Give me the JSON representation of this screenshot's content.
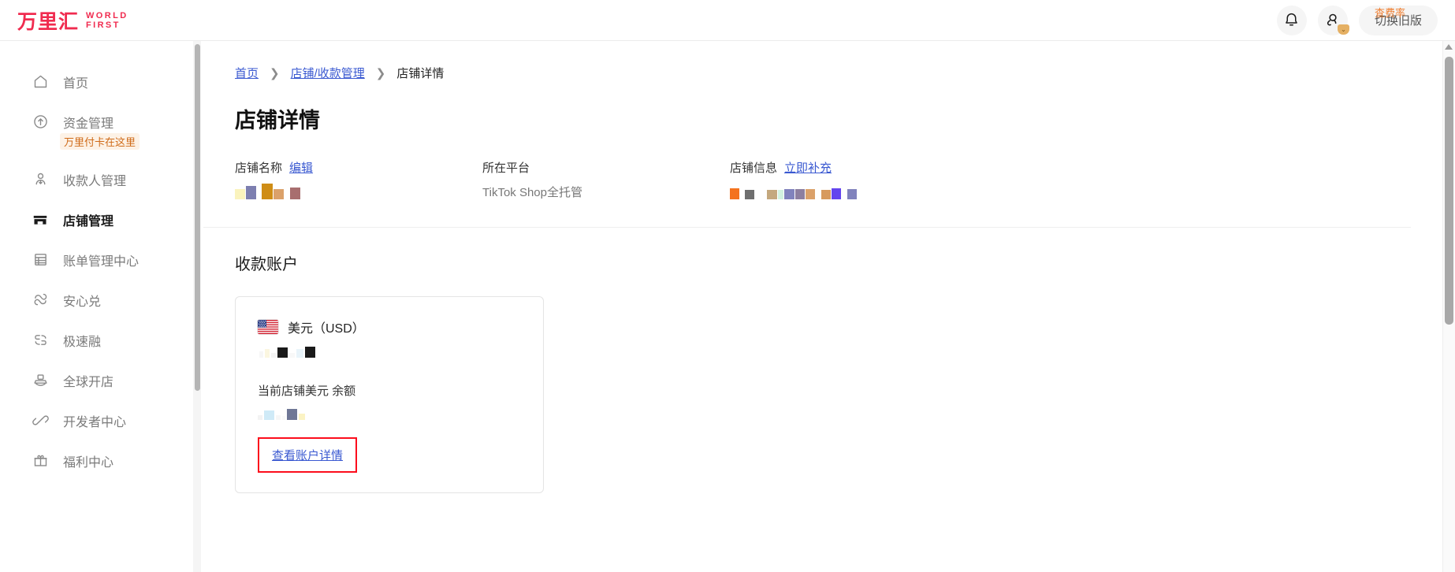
{
  "header": {
    "logo_cn": "万里汇",
    "logo_en_line1": "WORLD",
    "logo_en_line2": "FIRST",
    "rate_tip": "查费率",
    "switch_button": "切换旧版",
    "notification_icon": "bell-icon",
    "avatar_icon": "user-icon"
  },
  "sidebar": {
    "items": [
      {
        "label": "首页",
        "icon": "home-icon",
        "active": false
      },
      {
        "label": "资金管理",
        "icon": "arrow-up-circle-icon",
        "active": false,
        "badge": "万里付卡在这里"
      },
      {
        "label": "收款人管理",
        "icon": "payee-person-icon",
        "active": false
      },
      {
        "label": "店铺管理",
        "icon": "store-icon",
        "active": true
      },
      {
        "label": "账单管理中心",
        "icon": "bill-table-icon",
        "active": false
      },
      {
        "label": "安心兑",
        "icon": "exchange-shield-icon",
        "active": false
      },
      {
        "label": "极速融",
        "icon": "fast-finance-icon",
        "active": false
      },
      {
        "label": "全球开店",
        "icon": "global-shop-icon",
        "active": false
      },
      {
        "label": "开发者中心",
        "icon": "developer-link-icon",
        "active": false
      },
      {
        "label": "福利中心",
        "icon": "gift-icon",
        "active": false
      }
    ]
  },
  "breadcrumb": {
    "home": "首页",
    "parent": "店铺/收款管理",
    "current": "店铺详情",
    "separator": "❯"
  },
  "page": {
    "title": "店铺详情"
  },
  "shop_info": {
    "name_label": "店铺名称",
    "name_edit_link": "编辑",
    "name_value_masked": true,
    "platform_label": "所在平台",
    "platform_value": "TikTok Shop全托管",
    "info_label": "店铺信息",
    "info_link": "立即补充",
    "info_value_masked": true
  },
  "accounts_section": {
    "title": "收款账户",
    "card": {
      "flag": "us-flag-icon",
      "currency": "美元（USD）",
      "account_number_masked": true,
      "balance_label": "当前店铺美元 余额",
      "balance_masked": true,
      "detail_link": "查看账户详情"
    }
  },
  "colors": {
    "brand_red": "#f02b4f",
    "link_blue": "#3a59d1",
    "highlight_red": "#fc0d1c",
    "badge_orange": "#cf6a18",
    "rate_tip_orange": "#ef7d2e"
  },
  "masks": {
    "shop_name": [
      {
        "color": "#faf3bd",
        "w": 13,
        "h": 13
      },
      {
        "color": "#7d7fb0",
        "w": 13,
        "h": 17
      },
      {
        "color": "#ffffff",
        "w": 5,
        "h": 4
      },
      {
        "color": "#cf8d16",
        "w": 14,
        "h": 20
      },
      {
        "color": "#dba16a",
        "w": 13,
        "h": 13
      },
      {
        "color": "#ffffff",
        "w": 6,
        "h": 4
      },
      {
        "color": "#a86e6f",
        "w": 13,
        "h": 15
      }
    ],
    "shop_detail": [
      {
        "color": "#f4731e",
        "w": 12,
        "h": 14
      },
      {
        "color": "#ffffff",
        "w": 5,
        "h": 4
      },
      {
        "color": "#6f6f6f",
        "w": 12,
        "h": 12
      },
      {
        "color": "#ffffff",
        "w": 14,
        "h": 4
      },
      {
        "color": "#c4a87e",
        "w": 13,
        "h": 12
      },
      {
        "color": "#d2f2e0",
        "w": 7,
        "h": 12
      },
      {
        "color": "#8183bd",
        "w": 13,
        "h": 13
      },
      {
        "color": "#8d7fa0",
        "w": 12,
        "h": 13
      },
      {
        "color": "#dba16a",
        "w": 12,
        "h": 13
      },
      {
        "color": "#ffffff",
        "w": 6,
        "h": 4
      },
      {
        "color": "#d79a5e",
        "w": 12,
        "h": 12
      },
      {
        "color": "#6445ee",
        "w": 12,
        "h": 14
      },
      {
        "color": "#ffffff",
        "w": 6,
        "h": 4
      },
      {
        "color": "#8183bd",
        "w": 12,
        "h": 13
      }
    ],
    "account_number": [
      {
        "color": "#f6f6f6",
        "w": 5,
        "h": 8
      },
      {
        "color": "#fbf6e0",
        "w": 6,
        "h": 11
      },
      {
        "color": "#f4f4f4",
        "w": 6,
        "h": 6
      },
      {
        "color": "#1a1a1a",
        "w": 13,
        "h": 13
      },
      {
        "color": "#f8f8f8",
        "w": 7,
        "h": 6
      },
      {
        "color": "#e9f4fa",
        "w": 9,
        "h": 11
      },
      {
        "color": "#1a1a1a",
        "w": 13,
        "h": 14
      }
    ],
    "balance": [
      {
        "color": "#f3f3f3",
        "w": 6,
        "h": 6
      },
      {
        "color": "#cfeaf7",
        "w": 13,
        "h": 12
      },
      {
        "color": "#f6f6f6",
        "w": 6,
        "h": 6
      },
      {
        "color": "#fafafa",
        "w": 4,
        "h": 5
      },
      {
        "color": "#6f7796",
        "w": 13,
        "h": 14
      },
      {
        "color": "#fbf3c4",
        "w": 8,
        "h": 8
      }
    ]
  }
}
